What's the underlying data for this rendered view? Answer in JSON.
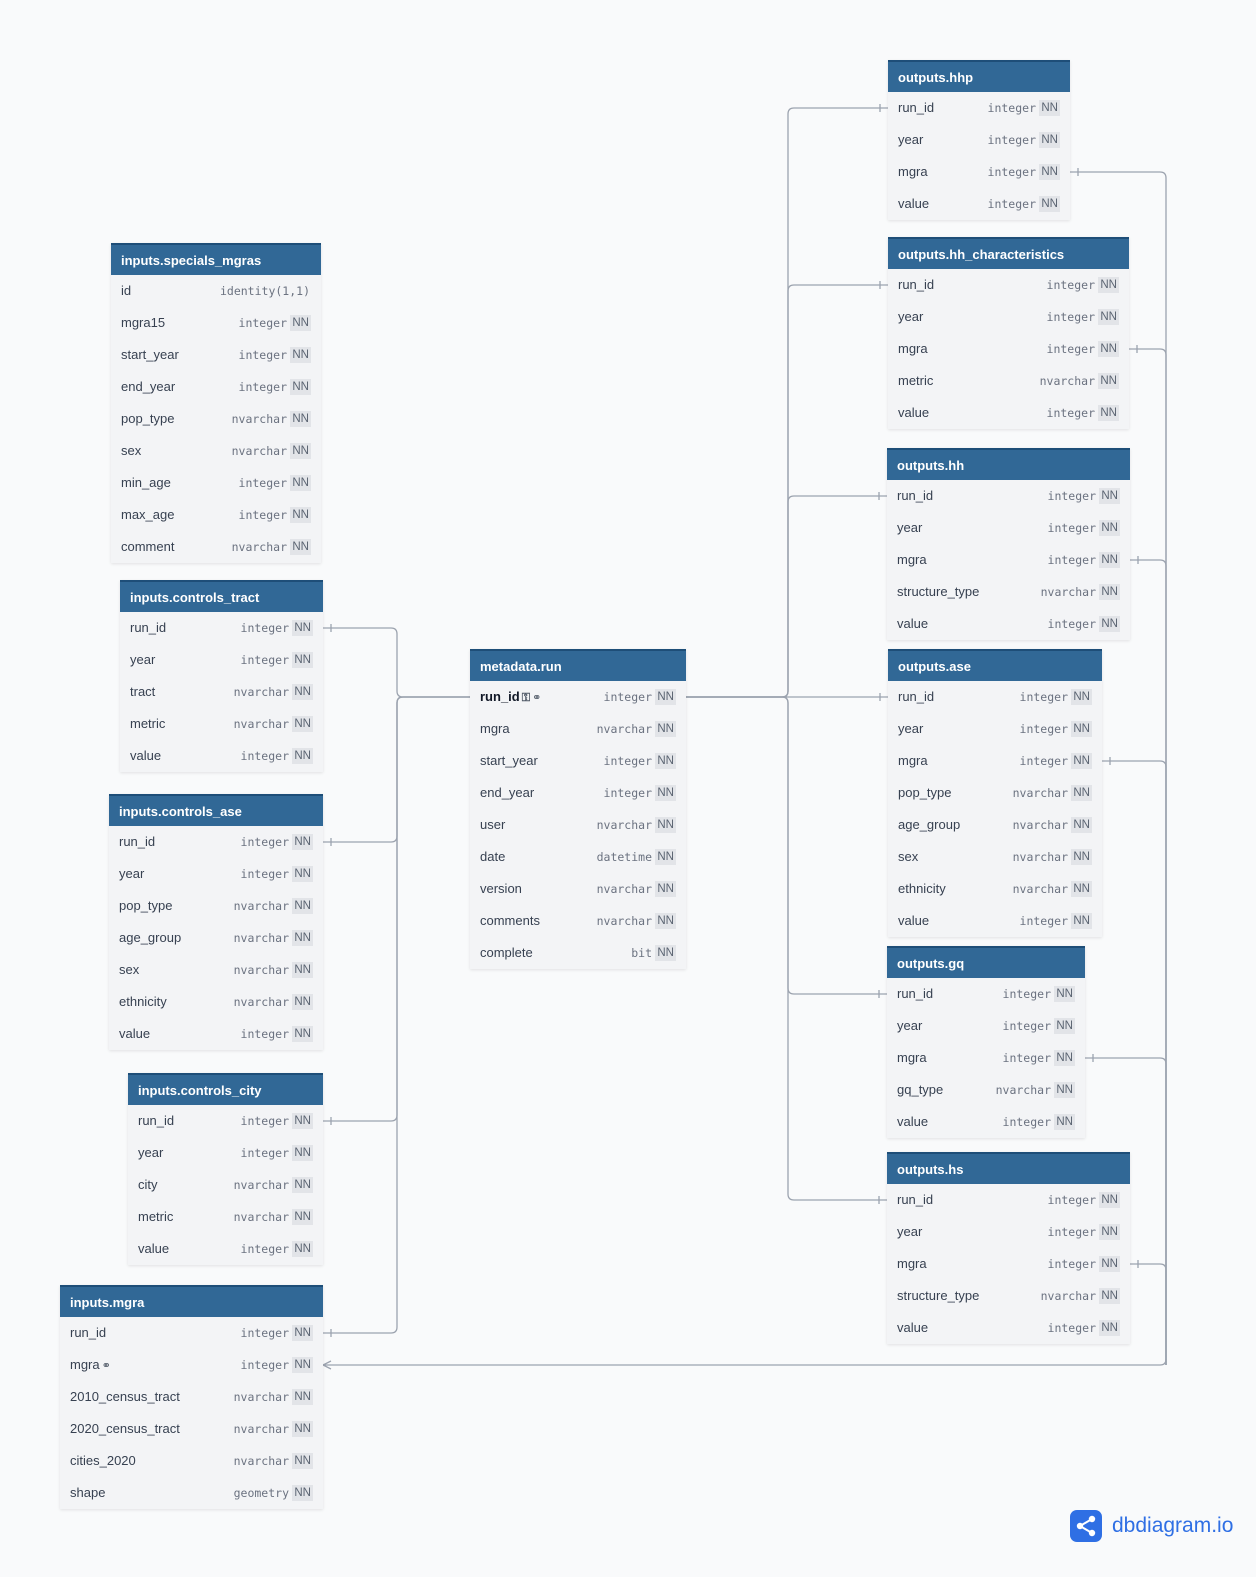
{
  "tables": [
    {
      "key": "specials_mgras",
      "name": "inputs.specials_mgras",
      "fields": [
        {
          "name": "id",
          "type": "identity(1,1)",
          "nn": ""
        },
        {
          "name": "mgra15",
          "type": "integer",
          "nn": "NN"
        },
        {
          "name": "start_year",
          "type": "integer",
          "nn": "NN"
        },
        {
          "name": "end_year",
          "type": "integer",
          "nn": "NN"
        },
        {
          "name": "pop_type",
          "type": "nvarchar",
          "nn": "NN"
        },
        {
          "name": "sex",
          "type": "nvarchar",
          "nn": "NN"
        },
        {
          "name": "min_age",
          "type": "integer",
          "nn": "NN"
        },
        {
          "name": "max_age",
          "type": "integer",
          "nn": "NN"
        },
        {
          "name": "comment",
          "type": "nvarchar",
          "nn": "NN"
        }
      ]
    },
    {
      "key": "controls_tract",
      "name": "inputs.controls_tract",
      "fields": [
        {
          "name": "run_id",
          "type": "integer",
          "nn": "NN"
        },
        {
          "name": "year",
          "type": "integer",
          "nn": "NN"
        },
        {
          "name": "tract",
          "type": "nvarchar",
          "nn": "NN"
        },
        {
          "name": "metric",
          "type": "nvarchar",
          "nn": "NN"
        },
        {
          "name": "value",
          "type": "integer",
          "nn": "NN"
        }
      ]
    },
    {
      "key": "controls_ase",
      "name": "inputs.controls_ase",
      "fields": [
        {
          "name": "run_id",
          "type": "integer",
          "nn": "NN"
        },
        {
          "name": "year",
          "type": "integer",
          "nn": "NN"
        },
        {
          "name": "pop_type",
          "type": "nvarchar",
          "nn": "NN"
        },
        {
          "name": "age_group",
          "type": "nvarchar",
          "nn": "NN"
        },
        {
          "name": "sex",
          "type": "nvarchar",
          "nn": "NN"
        },
        {
          "name": "ethnicity",
          "type": "nvarchar",
          "nn": "NN"
        },
        {
          "name": "value",
          "type": "integer",
          "nn": "NN"
        }
      ]
    },
    {
      "key": "controls_city",
      "name": "inputs.controls_city",
      "fields": [
        {
          "name": "run_id",
          "type": "integer",
          "nn": "NN"
        },
        {
          "name": "year",
          "type": "integer",
          "nn": "NN"
        },
        {
          "name": "city",
          "type": "nvarchar",
          "nn": "NN"
        },
        {
          "name": "metric",
          "type": "nvarchar",
          "nn": "NN"
        },
        {
          "name": "value",
          "type": "integer",
          "nn": "NN"
        }
      ]
    },
    {
      "key": "inputs_mgra",
      "name": "inputs.mgra",
      "fields": [
        {
          "name": "run_id",
          "type": "integer",
          "nn": "NN"
        },
        {
          "name": "mgra",
          "type": "integer",
          "nn": "NN",
          "icons": "link-icon"
        },
        {
          "name": "2010_census_tract",
          "type": "nvarchar",
          "nn": "NN"
        },
        {
          "name": "2020_census_tract",
          "type": "nvarchar",
          "nn": "NN"
        },
        {
          "name": "cities_2020",
          "type": "nvarchar",
          "nn": "NN"
        },
        {
          "name": "shape",
          "type": "geometry",
          "nn": "NN"
        }
      ]
    },
    {
      "key": "metadata_run",
      "name": "metadata.run",
      "fields": [
        {
          "name": "run_id",
          "type": "integer",
          "nn": "NN",
          "pk": true,
          "icons": "key-icon link-icon"
        },
        {
          "name": "mgra",
          "type": "nvarchar",
          "nn": "NN"
        },
        {
          "name": "start_year",
          "type": "integer",
          "nn": "NN"
        },
        {
          "name": "end_year",
          "type": "integer",
          "nn": "NN"
        },
        {
          "name": "user",
          "type": "nvarchar",
          "nn": "NN"
        },
        {
          "name": "date",
          "type": "datetime",
          "nn": "NN"
        },
        {
          "name": "version",
          "type": "nvarchar",
          "nn": "NN"
        },
        {
          "name": "comments",
          "type": "nvarchar",
          "nn": "NN"
        },
        {
          "name": "complete",
          "type": "bit",
          "nn": "NN"
        }
      ]
    },
    {
      "key": "outputs_hhp",
      "name": "outputs.hhp",
      "fields": [
        {
          "name": "run_id",
          "type": "integer",
          "nn": "NN"
        },
        {
          "name": "year",
          "type": "integer",
          "nn": "NN"
        },
        {
          "name": "mgra",
          "type": "integer",
          "nn": "NN"
        },
        {
          "name": "value",
          "type": "integer",
          "nn": "NN"
        }
      ]
    },
    {
      "key": "outputs_hh_char",
      "name": "outputs.hh_characteristics",
      "fields": [
        {
          "name": "run_id",
          "type": "integer",
          "nn": "NN"
        },
        {
          "name": "year",
          "type": "integer",
          "nn": "NN"
        },
        {
          "name": "mgra",
          "type": "integer",
          "nn": "NN"
        },
        {
          "name": "metric",
          "type": "nvarchar",
          "nn": "NN"
        },
        {
          "name": "value",
          "type": "integer",
          "nn": "NN"
        }
      ]
    },
    {
      "key": "outputs_hh",
      "name": "outputs.hh",
      "fields": [
        {
          "name": "run_id",
          "type": "integer",
          "nn": "NN"
        },
        {
          "name": "year",
          "type": "integer",
          "nn": "NN"
        },
        {
          "name": "mgra",
          "type": "integer",
          "nn": "NN"
        },
        {
          "name": "structure_type",
          "type": "nvarchar",
          "nn": "NN"
        },
        {
          "name": "value",
          "type": "integer",
          "nn": "NN"
        }
      ]
    },
    {
      "key": "outputs_ase",
      "name": "outputs.ase",
      "fields": [
        {
          "name": "run_id",
          "type": "integer",
          "nn": "NN"
        },
        {
          "name": "year",
          "type": "integer",
          "nn": "NN"
        },
        {
          "name": "mgra",
          "type": "integer",
          "nn": "NN"
        },
        {
          "name": "pop_type",
          "type": "nvarchar",
          "nn": "NN"
        },
        {
          "name": "age_group",
          "type": "nvarchar",
          "nn": "NN"
        },
        {
          "name": "sex",
          "type": "nvarchar",
          "nn": "NN"
        },
        {
          "name": "ethnicity",
          "type": "nvarchar",
          "nn": "NN"
        },
        {
          "name": "value",
          "type": "integer",
          "nn": "NN"
        }
      ]
    },
    {
      "key": "outputs_gq",
      "name": "outputs.gq",
      "fields": [
        {
          "name": "run_id",
          "type": "integer",
          "nn": "NN"
        },
        {
          "name": "year",
          "type": "integer",
          "nn": "NN"
        },
        {
          "name": "mgra",
          "type": "integer",
          "nn": "NN"
        },
        {
          "name": "gq_type",
          "type": "nvarchar",
          "nn": "NN"
        },
        {
          "name": "value",
          "type": "integer",
          "nn": "NN"
        }
      ]
    },
    {
      "key": "outputs_hs",
      "name": "outputs.hs",
      "fields": [
        {
          "name": "run_id",
          "type": "integer",
          "nn": "NN"
        },
        {
          "name": "year",
          "type": "integer",
          "nn": "NN"
        },
        {
          "name": "mgra",
          "type": "integer",
          "nn": "NN"
        },
        {
          "name": "structure_type",
          "type": "nvarchar",
          "nn": "NN"
        },
        {
          "name": "value",
          "type": "integer",
          "nn": "NN"
        }
      ]
    }
  ],
  "relationships": [
    {
      "from": "inputs.controls_tract.run_id",
      "to": "metadata.run.run_id"
    },
    {
      "from": "inputs.controls_ase.run_id",
      "to": "metadata.run.run_id"
    },
    {
      "from": "inputs.controls_city.run_id",
      "to": "metadata.run.run_id"
    },
    {
      "from": "inputs.mgra.run_id",
      "to": "metadata.run.run_id"
    },
    {
      "from": "outputs.hhp.run_id",
      "to": "metadata.run.run_id"
    },
    {
      "from": "outputs.hh_characteristics.run_id",
      "to": "metadata.run.run_id"
    },
    {
      "from": "outputs.hh.run_id",
      "to": "metadata.run.run_id"
    },
    {
      "from": "outputs.ase.run_id",
      "to": "metadata.run.run_id"
    },
    {
      "from": "outputs.gq.run_id",
      "to": "metadata.run.run_id"
    },
    {
      "from": "outputs.hs.run_id",
      "to": "metadata.run.run_id"
    },
    {
      "from": "outputs.hhp.mgra",
      "to": "inputs.mgra.mgra"
    },
    {
      "from": "outputs.hh_characteristics.mgra",
      "to": "inputs.mgra.mgra"
    },
    {
      "from": "outputs.hh.mgra",
      "to": "inputs.mgra.mgra"
    },
    {
      "from": "outputs.ase.mgra",
      "to": "inputs.mgra.mgra"
    },
    {
      "from": "outputs.gq.mgra",
      "to": "inputs.mgra.mgra"
    },
    {
      "from": "outputs.hs.mgra",
      "to": "inputs.mgra.mgra"
    }
  ],
  "colors": {
    "header": "#316896",
    "body": "#f3f4f6",
    "link": "#9ca3af",
    "brand": "#2f6fe4"
  },
  "brand": {
    "text": "dbdiagram.io",
    "icon": "share-nodes-icon"
  }
}
